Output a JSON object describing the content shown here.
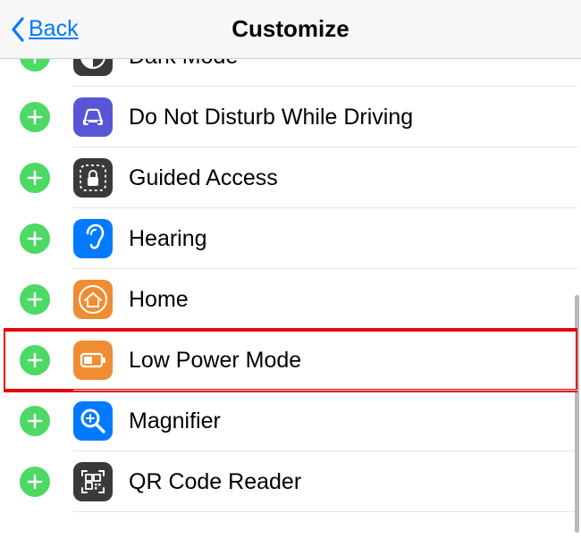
{
  "header": {
    "back_label": "Back",
    "title": "Customize"
  },
  "rows": [
    {
      "label": "Dark Mode",
      "icon": "dark-mode-icon",
      "icon_bg": "#3a3a3c",
      "highlight": false
    },
    {
      "label": "Do Not Disturb While Driving",
      "icon": "car-icon",
      "icon_bg": "#5856d6",
      "highlight": false
    },
    {
      "label": "Guided Access",
      "icon": "lock-icon",
      "icon_bg": "#3a3a3c",
      "highlight": false
    },
    {
      "label": "Hearing",
      "icon": "ear-icon",
      "icon_bg": "#027aff",
      "highlight": false
    },
    {
      "label": "Home",
      "icon": "home-icon",
      "icon_bg": "#ef8d33",
      "highlight": false
    },
    {
      "label": "Low Power Mode",
      "icon": "battery-icon",
      "icon_bg": "#ef8d33",
      "highlight": true
    },
    {
      "label": "Magnifier",
      "icon": "magnifier-icon",
      "icon_bg": "#027aff",
      "highlight": false
    },
    {
      "label": "QR Code Reader",
      "icon": "qr-icon",
      "icon_bg": "#3a3a3c",
      "highlight": false
    }
  ]
}
